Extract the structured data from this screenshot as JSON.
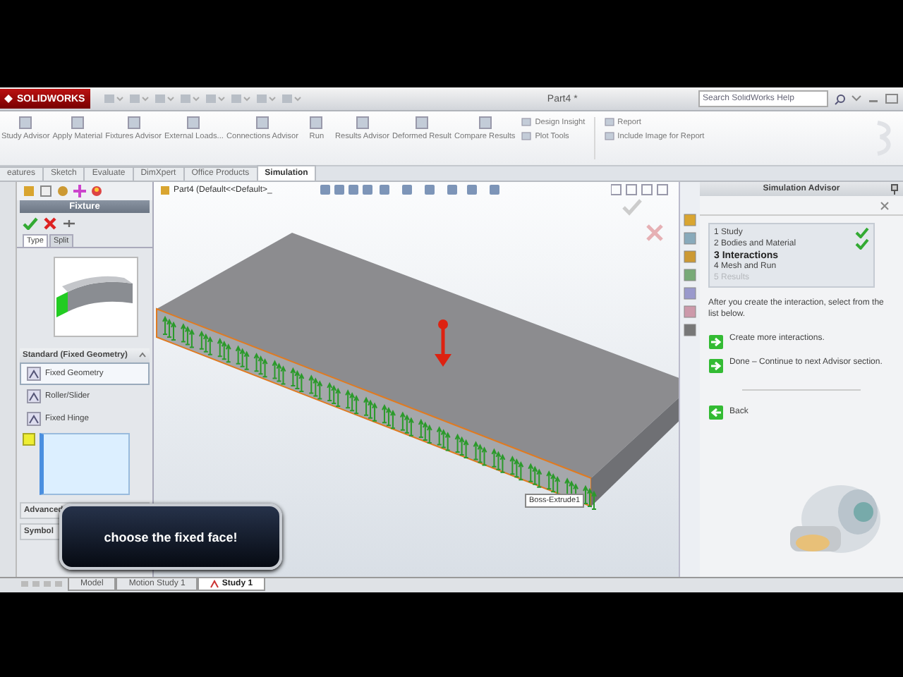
{
  "window": {
    "logo": "SOLIDWORKS",
    "title": "Part4 *",
    "search": {
      "placeholder": "Search SolidWorks Help"
    }
  },
  "ribbon": {
    "buttons": [
      {
        "label": "Study Advisor"
      },
      {
        "label": "Apply Material"
      },
      {
        "label": "Fixtures Advisor"
      },
      {
        "label": "External Loads..."
      },
      {
        "label": "Connections Advisor"
      },
      {
        "label": "Run"
      },
      {
        "label": "Results Advisor"
      },
      {
        "label": "Deformed Result"
      },
      {
        "label": "Compare Results"
      }
    ],
    "small_buttons": [
      {
        "label": "Design Insight"
      },
      {
        "label": "Plot Tools"
      },
      {
        "label": "Report"
      },
      {
        "label": "Include Image for Report"
      }
    ]
  },
  "command_tabs": [
    {
      "label": "eatures",
      "selected": false
    },
    {
      "label": "Sketch",
      "selected": false
    },
    {
      "label": "Evaluate",
      "selected": false
    },
    {
      "label": "DimXpert",
      "selected": false
    },
    {
      "label": "Office Products",
      "selected": false
    },
    {
      "label": "Simulation",
      "selected": true
    }
  ],
  "fixture_panel": {
    "title": "Fixture",
    "tabs": [
      {
        "label": "Type",
        "selected": true
      },
      {
        "label": "Split",
        "selected": false
      }
    ],
    "section": "Standard (Fixed Geometry)",
    "options": [
      {
        "label": "Fixed Geometry",
        "selected": true
      },
      {
        "label": "Roller/Slider",
        "selected": false
      },
      {
        "label": "Fixed Hinge",
        "selected": false
      }
    ],
    "advanced": "Advanced",
    "symbol": "Symbol"
  },
  "viewport": {
    "tree_label": "Part4  (Default<<Default>_",
    "tooltip": "Boss-Extrude1"
  },
  "advisor": {
    "title": "Simulation Advisor",
    "steps": [
      {
        "number": "1",
        "label": "Study",
        "done": true,
        "current": false,
        "disabled": false
      },
      {
        "number": "2",
        "label": "Bodies and Material",
        "done": true,
        "current": false,
        "disabled": false
      },
      {
        "number": "3",
        "label": "Interactions",
        "done": false,
        "current": true,
        "disabled": false
      },
      {
        "number": "4",
        "label": "Mesh and Run",
        "done": false,
        "current": false,
        "disabled": false
      },
      {
        "number": "5",
        "label": "Results",
        "done": false,
        "current": false,
        "disabled": true
      }
    ],
    "instruction": "After you create the interaction, select from the list below.",
    "actions": [
      {
        "label": "Create more interactions."
      },
      {
        "label": "Done – Continue to next Advisor section."
      }
    ],
    "back": "Back"
  },
  "bottom_tabs": [
    {
      "label": "Model",
      "selected": false
    },
    {
      "label": "Motion Study 1",
      "selected": false
    },
    {
      "label": "Study 1",
      "selected": true
    }
  ],
  "callout": "choose the fixed face!"
}
